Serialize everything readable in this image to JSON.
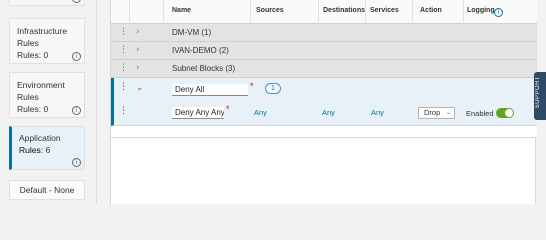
{
  "sidebar": {
    "cards": [
      {
        "title": "Infrastructure Rules",
        "rules": "Rules: 0"
      },
      {
        "title": "Environment Rules",
        "rules": "Rules: 0"
      },
      {
        "title": "Application Rules",
        "rules": "Rules: 6"
      }
    ],
    "default_button": "Default - None",
    "info_glyph": "i"
  },
  "grid": {
    "headers": {
      "name": "Name",
      "sources": "Sources",
      "destinations": "Destinations",
      "services": "Services",
      "action": "Action",
      "logging": "Logging"
    },
    "groups": [
      {
        "name": "DM-VM (1)"
      },
      {
        "name": "IVAN-DEMO (2)"
      },
      {
        "name": "Subnet Blocks (3)"
      }
    ],
    "section": {
      "name_value": "Deny All",
      "badge": "1",
      "rule": {
        "name_value": "Deny Any Any",
        "sources": "Any",
        "destinations": "Any",
        "services": "Any",
        "action": "Drop",
        "logging_label": "Enabled",
        "logging_on": true
      }
    },
    "required_mark": "*"
  },
  "support_tab": "SUPPORT",
  "colors": {
    "accent": "#0072a3",
    "toggle_on": "#62a420",
    "required": "#c21d00",
    "support_bg": "#2f4a66"
  }
}
